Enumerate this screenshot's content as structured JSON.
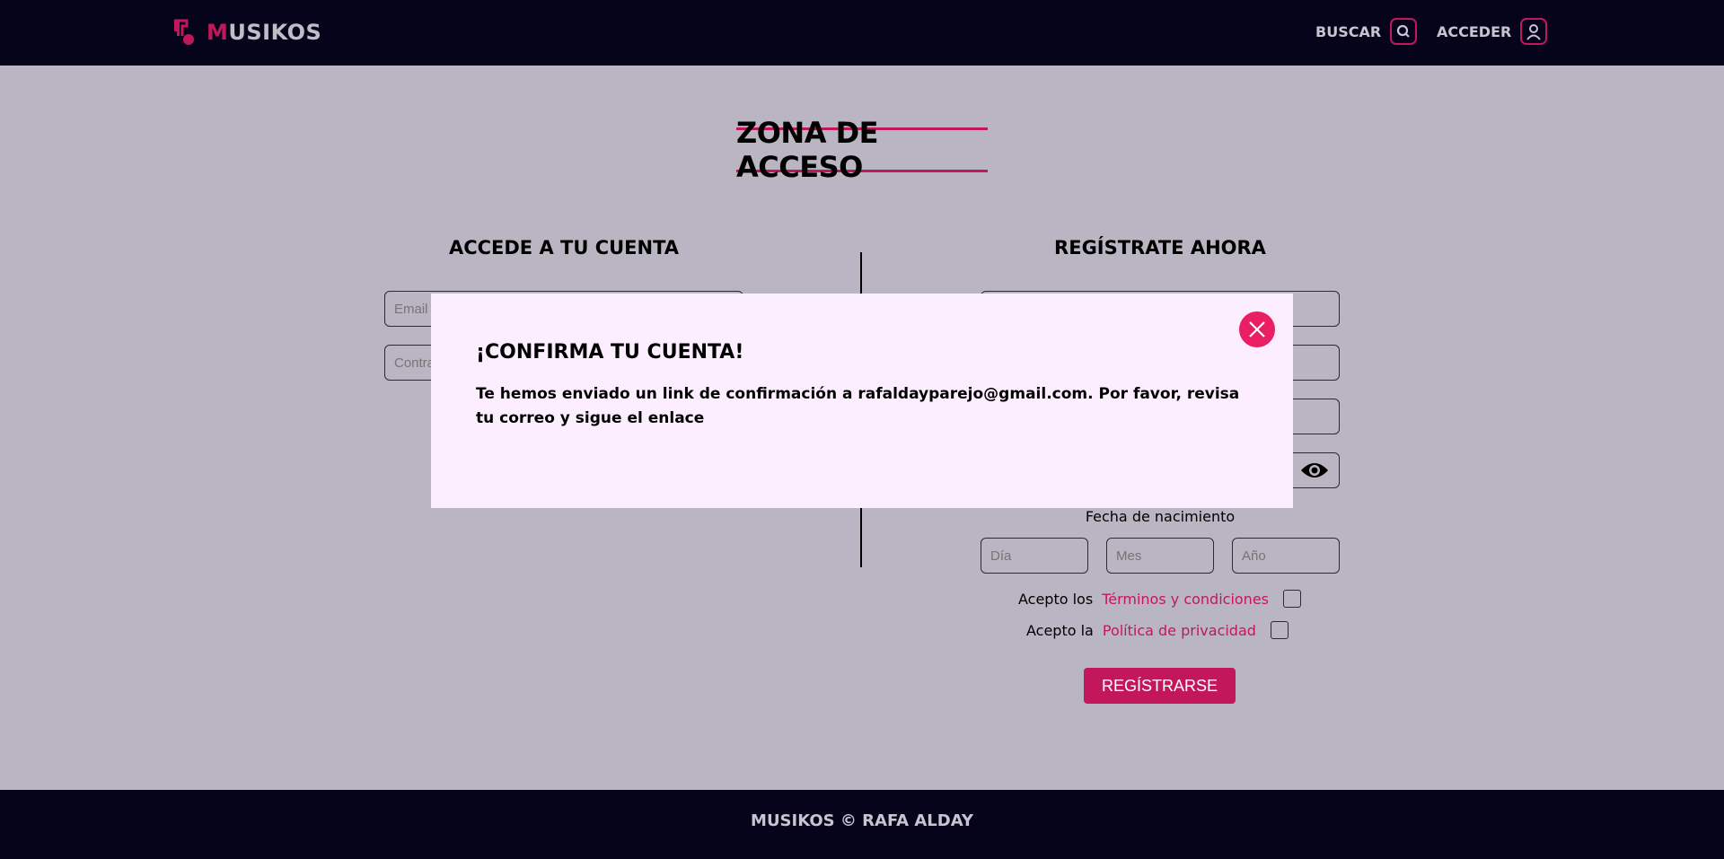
{
  "header": {
    "brand_first": "M",
    "brand_rest": "USIKOS",
    "search_label": "BUSCAR",
    "login_label": "ACCEDER",
    "icons": {
      "logo": "music-note-icon",
      "search": "search-icon",
      "user": "user-icon"
    }
  },
  "main": {
    "title": "ZONA DE ACCESO",
    "login": {
      "title": "ACCEDE A TU CUENTA",
      "email_placeholder": "Email",
      "password_placeholder": "Contraseña"
    },
    "register": {
      "title": "REGÍSTRATE AHORA",
      "dob_label": "Fecha de nacimiento",
      "day_placeholder": "Día",
      "month_placeholder": "Mes",
      "year_placeholder": "Año",
      "terms_prefix": "Acepto los",
      "terms_link": "Términos y condiciones",
      "privacy_prefix": "Acepto la",
      "privacy_link": "Política de privacidad",
      "submit_label": "REGÍSTRARSE"
    }
  },
  "modal": {
    "title": "¡CONFIRMA TU CUENTA!",
    "message": "Te hemos enviado un link de confirmación a rafaldayparejo@gmail.com. Por favor, revisa tu correo y sigue el enlace"
  },
  "footer": {
    "text": "MUSIKOS © RAFA ALDAY"
  },
  "colors": {
    "accent": "#c2185b",
    "close": "#e91e63",
    "header_bg": "#05041a",
    "page_bg": "#bab5c2",
    "modal_bg": "#fdeeff"
  }
}
